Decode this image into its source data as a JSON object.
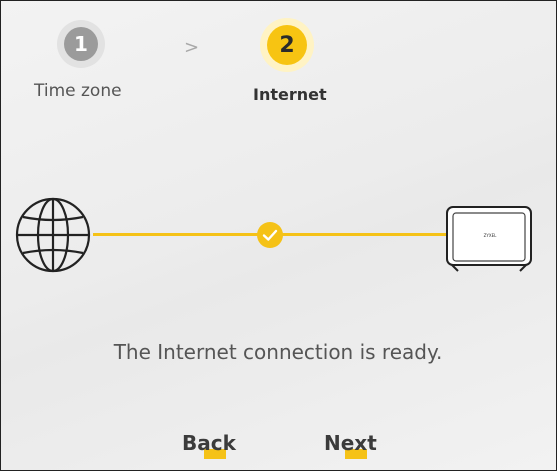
{
  "steps": [
    {
      "number": "1",
      "label": "Time zone",
      "state": "inactive"
    },
    {
      "number": "2",
      "label": "Internet",
      "state": "active"
    }
  ],
  "step_separator": ">",
  "status": {
    "message": "The Internet connection is ready.",
    "state_icon": "check-icon"
  },
  "icons": {
    "left": "globe-icon",
    "middle": "check-icon",
    "right": "router-icon",
    "router_label": "ZYXEL"
  },
  "buttons": {
    "back_label": "Back",
    "next_label": "Next"
  },
  "colors": {
    "accent": "#f5c217",
    "step_inactive": "#9b9b9b",
    "text": "#555555"
  }
}
